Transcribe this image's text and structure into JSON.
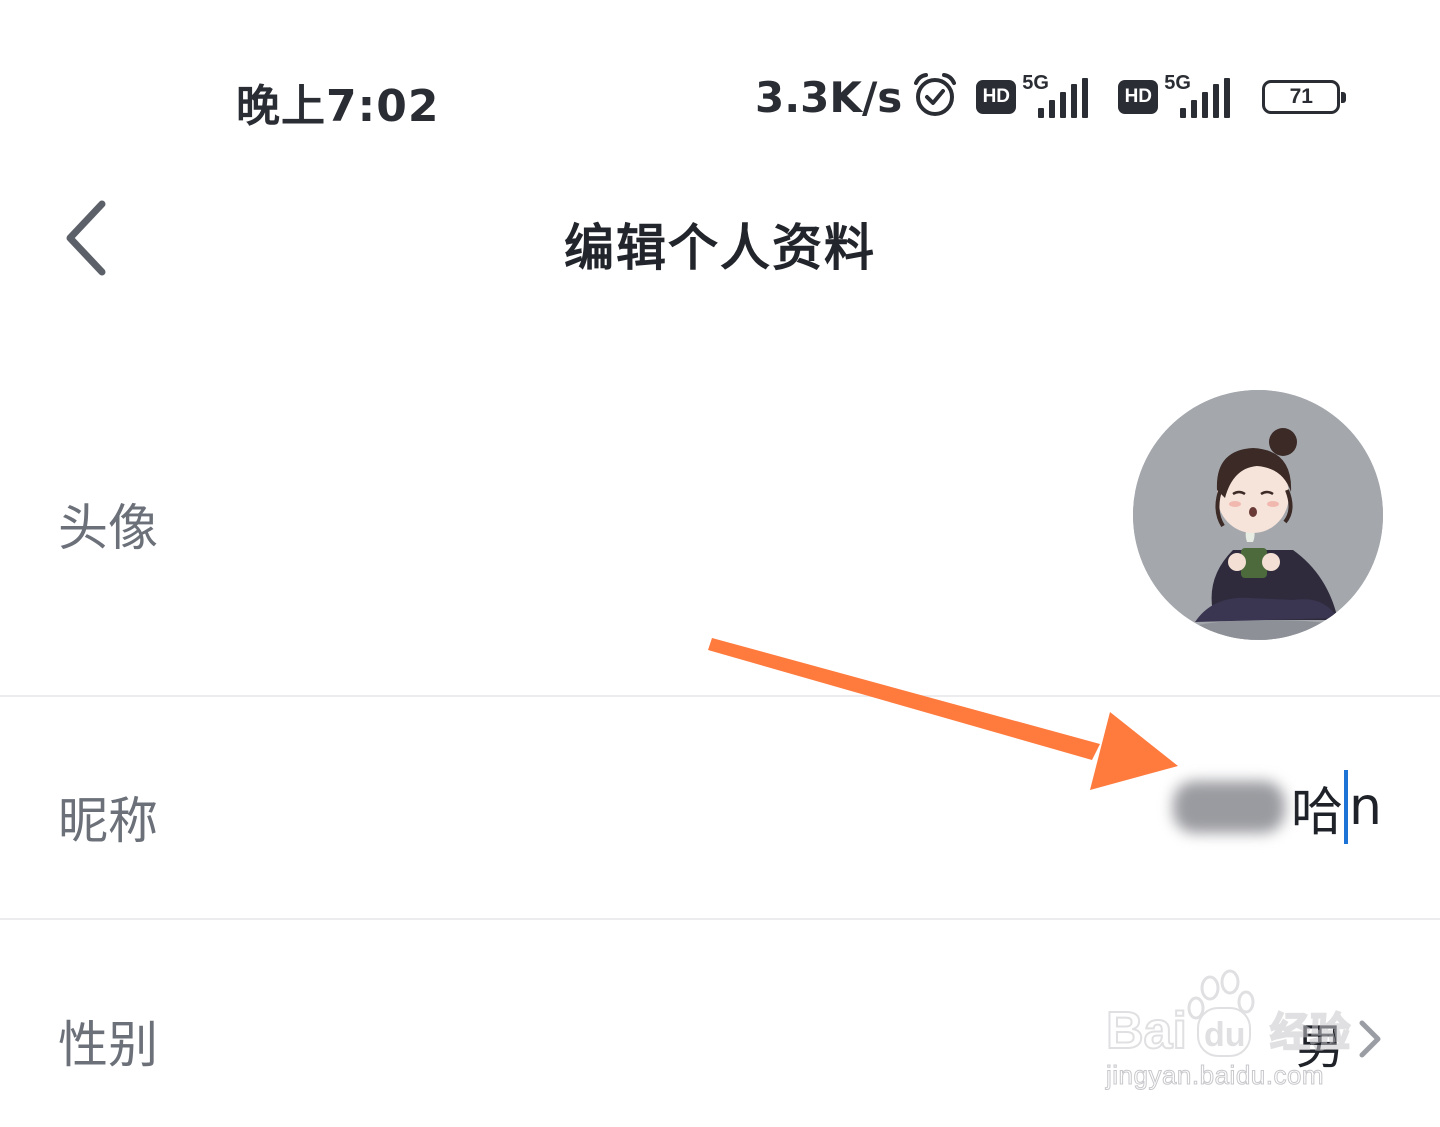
{
  "status_bar": {
    "time": "晚上7:02",
    "net_speed": "3.3K/s",
    "alarm_icon": "alarm-clock-icon",
    "hd_label": "HD",
    "signal_tag": "5G",
    "battery_level": "71"
  },
  "header": {
    "back_icon": "chevron-left-icon",
    "title": "编辑个人资料"
  },
  "profile": {
    "avatar": {
      "label": "头像",
      "image": "cartoon-character-avatar"
    },
    "nickname": {
      "label": "昵称",
      "visible_value": "哈",
      "typed_char": "n"
    },
    "gender": {
      "label": "性别",
      "value": "男",
      "chevron_icon": "chevron-right-icon"
    }
  },
  "annotation": {
    "arrow_color": "#ff7a3d"
  },
  "watermark": {
    "brand": "Baidu",
    "brand_suffix": "经验",
    "url": "jingyan.baidu.com"
  },
  "colors": {
    "caret": "#1e74d6",
    "label_text": "#6b7079",
    "value_text": "#1f2229",
    "divider": "#ececee"
  }
}
